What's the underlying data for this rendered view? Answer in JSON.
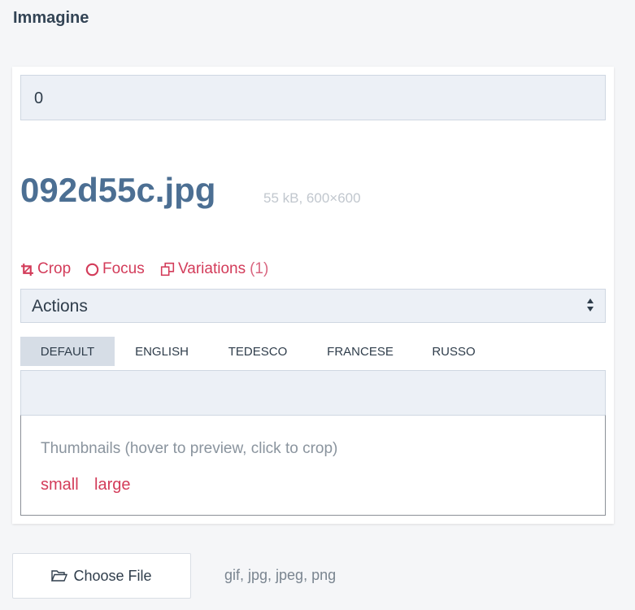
{
  "section": {
    "title": "Immagine"
  },
  "image": {
    "alt_value": "0",
    "filename": "092d55c.jpg",
    "meta": "55 kB, 600×600"
  },
  "toolbar": {
    "crop_label": "Crop",
    "focus_label": "Focus",
    "variations_label": "Variations",
    "variations_count": "(1)"
  },
  "actions": {
    "selected": "Actions"
  },
  "tabs": [
    {
      "label": "DEFAULT",
      "active": true
    },
    {
      "label": "ENGLISH",
      "active": false
    },
    {
      "label": "TEDESCO",
      "active": false
    },
    {
      "label": "FRANCESE",
      "active": false
    },
    {
      "label": "RUSSO",
      "active": false
    }
  ],
  "thumbnails": {
    "hint": "Thumbnails (hover to preview, click to crop)",
    "links": [
      "small",
      "large"
    ]
  },
  "upload": {
    "button_label": "Choose File",
    "accepted_types": "gif, jpg, jpeg, png"
  },
  "colors": {
    "accent": "#d33c5a",
    "filename": "#4c6f93",
    "field_bg": "#ecf0f6",
    "active_tab_bg": "#d6dde6"
  },
  "icons": [
    "crop-icon",
    "focus-circle-icon",
    "variations-icon",
    "select-arrows-icon",
    "folder-open-icon"
  ]
}
